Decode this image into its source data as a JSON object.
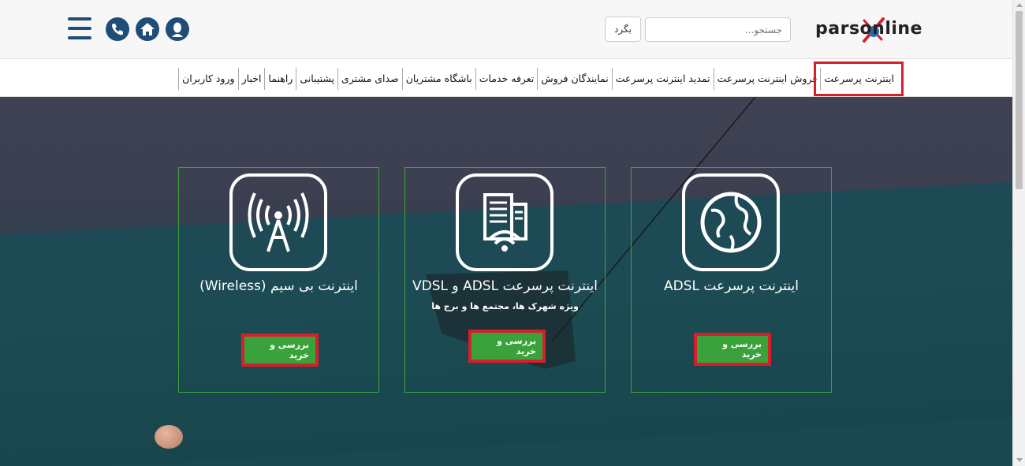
{
  "header": {
    "logo_text": "parsonline",
    "search": {
      "placeholder": "جستجو..."
    },
    "back_label": "بگرد",
    "icons": [
      "user-icon",
      "home-icon",
      "phone-icon",
      "menu-icon"
    ]
  },
  "nav": {
    "items": [
      {
        "label": "اینترنت پرسرعت",
        "active": true
      },
      {
        "label": "فروش اینترنت پرسرعت"
      },
      {
        "label": "تمدید اینترنت پرسرعت"
      },
      {
        "label": "نمایندگان فروش"
      },
      {
        "label": "تعرفه خدمات"
      },
      {
        "label": "باشگاه مشتریان"
      },
      {
        "label": "صدای مشتری"
      },
      {
        "label": "پشتیبانی"
      },
      {
        "label": "راهنما"
      },
      {
        "label": "اخبار"
      },
      {
        "label": "ورود کاربران"
      }
    ]
  },
  "cards": [
    {
      "title": "اینترنت پرسرعت ADSL",
      "subtitle": "",
      "button": "بررسی و خرید",
      "icon": "globe-icon"
    },
    {
      "title": "اینترنت پرسرعت ADSL و VDSL",
      "subtitle": "ویژه شهرک ها، مجتمع ها و برج ها",
      "button": "بررسی و خرید",
      "icon": "building-wifi-icon"
    },
    {
      "title": "اینترنت بی سیم (Wireless)",
      "subtitle": "",
      "button": "بررسی و خرید",
      "icon": "antenna-tower-icon"
    }
  ],
  "colors": {
    "brand_blue": "#1e4d78",
    "highlight_red": "#d71f2b",
    "button_green": "#3aa23a",
    "card_border_green": "#3ea43e"
  }
}
